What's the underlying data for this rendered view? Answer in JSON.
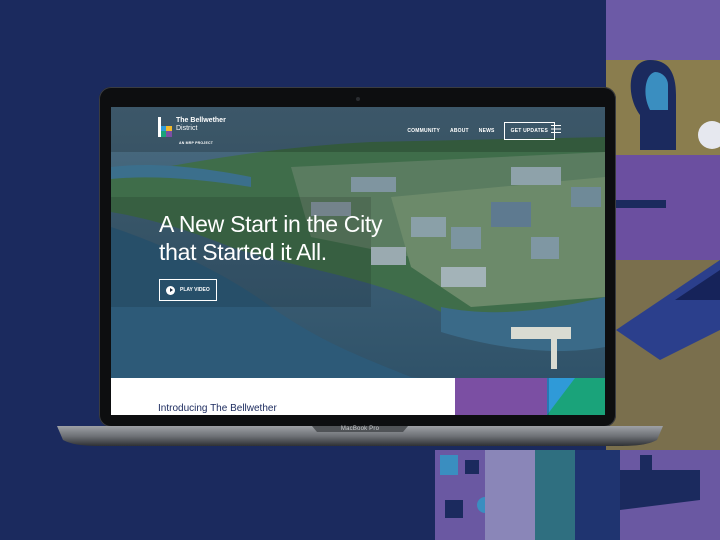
{
  "site": {
    "logo_title": "The Bellwether",
    "logo_sub": "District",
    "logo_tag": "AN MRP PROJECT",
    "nav": [
      "COMMUNITY",
      "ABOUT",
      "NEWS"
    ],
    "cta": "GET UPDATES",
    "hero_line1": "A New Start in the City",
    "hero_line2": "that Started it All.",
    "play": "PLAY VIDEO",
    "intro": "Introducing The Bellwether"
  },
  "device_label": "MacBook Pro",
  "colors": {
    "background": "#1b2a5e",
    "purple": "#6b4fa0",
    "gold": "#8a7a4a",
    "teal": "#3a8aa0",
    "green": "#1aa37a"
  }
}
